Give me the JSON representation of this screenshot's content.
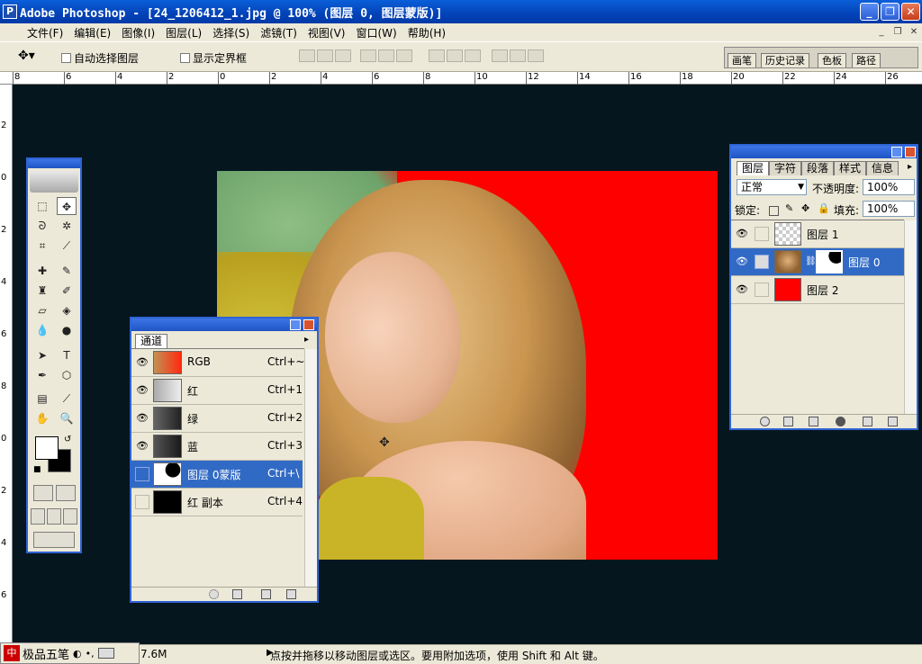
{
  "window": {
    "title": "Adobe Photoshop - [24_1206412_1.jpg @ 100% (图层 0, 图层蒙版)]",
    "app_icon": "photoshop-icon"
  },
  "menu": [
    "文件(F)",
    "编辑(E)",
    "图像(I)",
    "图层(L)",
    "选择(S)",
    "滤镜(T)",
    "视图(V)",
    "窗口(W)",
    "帮助(H)"
  ],
  "options": {
    "auto_select_layer": "自动选择图层",
    "show_bounding_box": "显示定界框"
  },
  "palette_well": [
    "画笔",
    "历史记录",
    "色板",
    "路径"
  ],
  "ruler_h": [
    "8",
    "6",
    "4",
    "2",
    "0",
    "2",
    "4",
    "6",
    "8",
    "10",
    "12",
    "14",
    "16",
    "18",
    "20",
    "22",
    "24",
    "26"
  ],
  "ruler_v": [
    "2",
    "0",
    "2",
    "4",
    "6",
    "8",
    "0",
    "2",
    "4",
    "6"
  ],
  "channels": {
    "tab": "通道",
    "rows": [
      {
        "name": "RGB",
        "shortcut": "Ctrl+~"
      },
      {
        "name": "红",
        "shortcut": "Ctrl+1"
      },
      {
        "name": "绿",
        "shortcut": "Ctrl+2"
      },
      {
        "name": "蓝",
        "shortcut": "Ctrl+3"
      },
      {
        "name": "图层 0蒙版",
        "shortcut": "Ctrl+\\"
      },
      {
        "name": "红 副本",
        "shortcut": "Ctrl+4"
      }
    ]
  },
  "layers": {
    "tabs": [
      "图层",
      "字符",
      "段落",
      "样式",
      "信息"
    ],
    "blend_mode": "正常",
    "opacity_label": "不透明度:",
    "opacity": "100%",
    "lock_label": "锁定:",
    "fill_label": "填充:",
    "fill": "100%",
    "rows": [
      {
        "name": "图层 1"
      },
      {
        "name": "图层 0"
      },
      {
        "name": "图层 2"
      }
    ]
  },
  "status": {
    "ime_label": "极品五笔",
    "doc_size": "7.6M",
    "tip": "点按并拖移以移动图层或选区。要用附加选项，使用 Shift 和 Alt 键。"
  },
  "colors": {
    "accent": "#2f63d3",
    "selection": "#316ac5",
    "canvas_bg": "#05161f",
    "layer2_fill": "#ff0000"
  }
}
